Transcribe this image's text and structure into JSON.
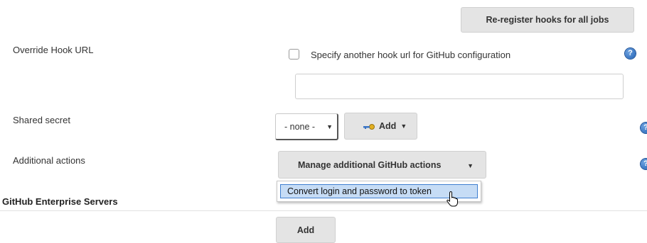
{
  "buttons": {
    "reregister": "Re-register hooks for all jobs",
    "add_credential": "Add",
    "manage_actions": "Manage additional GitHub actions",
    "add_server": "Add"
  },
  "override_hook": {
    "label": "Override Hook URL",
    "checkbox_label": "Specify another hook url for GitHub configuration",
    "checked": false,
    "url_value": ""
  },
  "shared_secret": {
    "label": "Shared secret",
    "selected": "- none -"
  },
  "additional_actions": {
    "label": "Additional actions",
    "menu_items": [
      "Convert login and password to token"
    ]
  },
  "enterprise": {
    "heading": "GitHub Enterprise Servers"
  },
  "icons": {
    "help": "?",
    "caret": "▼",
    "key": "key-icon",
    "cursor": "pointer-hand-cursor"
  },
  "colors": {
    "button_bg": "#e4e4e4",
    "menu_highlight": "#c6dcf5",
    "menu_highlight_border": "#3f7fd0",
    "help_blue": "#1f5fb3"
  }
}
